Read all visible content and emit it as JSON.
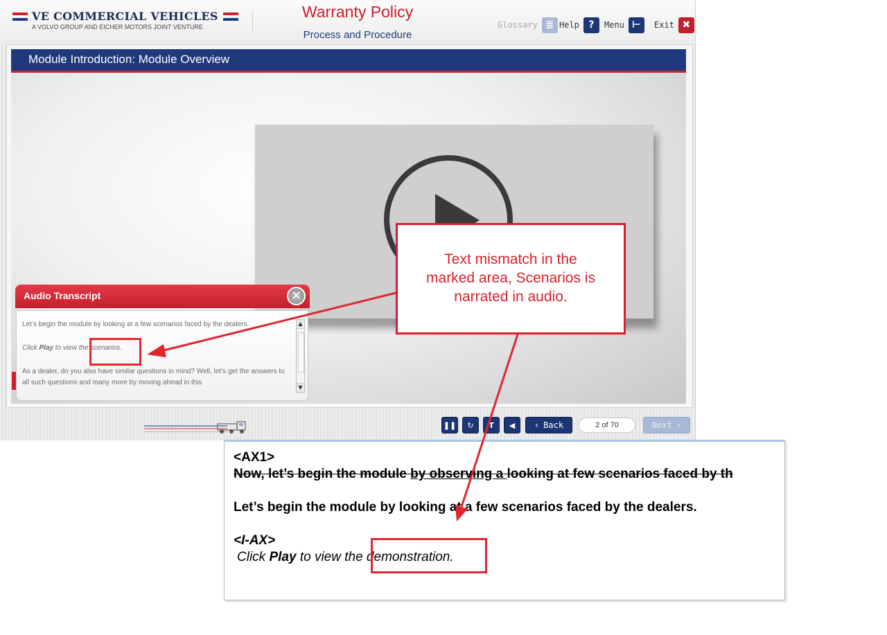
{
  "header": {
    "logo_title": "VE COMMERCIAL VEHICLES",
    "logo_subtitle": "A VOLVO GROUP AND EICHER MOTORS JOINT VENTURE",
    "course_title": "Warranty Policy",
    "course_subtitle": "Process and Procedure",
    "toolbar": {
      "glossary_label": "Glossary",
      "help_label": "Help",
      "menu_label": "Menu",
      "exit_label": "Exit"
    }
  },
  "module": {
    "title": "Module Introduction: Module Overview"
  },
  "transcript": {
    "title": "Audio Transcript",
    "para1": "Let’s begin the module by looking at a few scenarios faced by the dealers.",
    "para2_pre": "Click ",
    "para2_bold": "Play",
    "para2_post": " to view the scenarios.",
    "para3": "As a dealer, do you also have similar questions in mind? Well, let’s get the answers to all such questions and many more by moving ahead in this"
  },
  "controls": {
    "back_label": "Back",
    "page_indicator": "2 of 70",
    "next_label": "Next"
  },
  "callout": {
    "line1": "Text mismatch in the",
    "line2": "marked area, Scenarios is",
    "line3": "narrated in audio."
  },
  "script_doc": {
    "tag1": "<AX1>",
    "strike_pre": "Now, let’s begin the module ",
    "strike_ul": "by observing a ",
    "strike_post": "looking at few scenarios faced by th",
    "line_main": "Let’s begin the module by looking at a few scenarios faced by the dealers.",
    "tag2": "<I-AX>",
    "click_pre": "Click ",
    "click_bold": "Play",
    "click_post": " to view the demonstration."
  },
  "colors": {
    "brand_blue": "#1f3a7c",
    "brand_red": "#d01f2c",
    "annotation_red": "#e0252f"
  }
}
